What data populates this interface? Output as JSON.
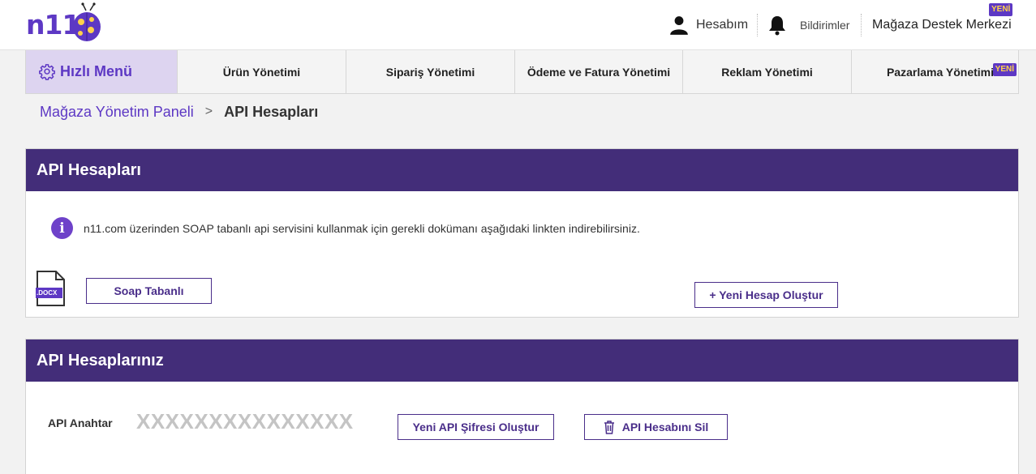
{
  "header": {
    "logo_text": "n11",
    "account_label": "Hesabım",
    "notifications_label": "Bildirimler",
    "support_label": "Mağaza Destek Merkezi",
    "support_badge": "YENİ"
  },
  "nav": {
    "quick_menu": "Hızlı Menü",
    "items": [
      {
        "label": "Ürün Yönetimi"
      },
      {
        "label": "Sipariş Yönetimi"
      },
      {
        "label": "Ödeme ve Fatura Yönetimi"
      },
      {
        "label": "Reklam Yönetimi"
      },
      {
        "label": "Pazarlama Yönetimi",
        "badge": "YENİ"
      }
    ]
  },
  "breadcrumb": {
    "parent": "Mağaza Yönetim Paneli",
    "separator": ">",
    "current": "API Hesapları"
  },
  "api_accounts_panel": {
    "title": "API Hesapları",
    "info_icon": "i",
    "info_text": "n11.com üzerinden SOAP tabanlı api servisini kullanmak için gerekli dokümanı aşağıdaki linkten indirebilirsiniz.",
    "docx_label": ".DOCX",
    "soap_button": "Soap Tabanlı",
    "new_account_button": "+ Yeni Hesap Oluştur"
  },
  "your_api_accounts_panel": {
    "title": "API Hesaplarınız",
    "key_label": "API Anahtar",
    "key_value": "XXXXXXXXXXXXXXX",
    "new_password_button": "Yeni API Şifresi Oluştur",
    "delete_button": "API Hesabını Sil"
  },
  "colors": {
    "brand_purple": "#5d38c4",
    "panel_header": "#432d79",
    "badge_text": "#ffd24a",
    "quick_menu_bg": "#ddd4f0"
  },
  "icons": [
    "n11-logo",
    "user-icon",
    "bell-icon",
    "gear-icon",
    "chevron-right-icon",
    "info-icon",
    "docx-file-icon",
    "trash-icon"
  ]
}
